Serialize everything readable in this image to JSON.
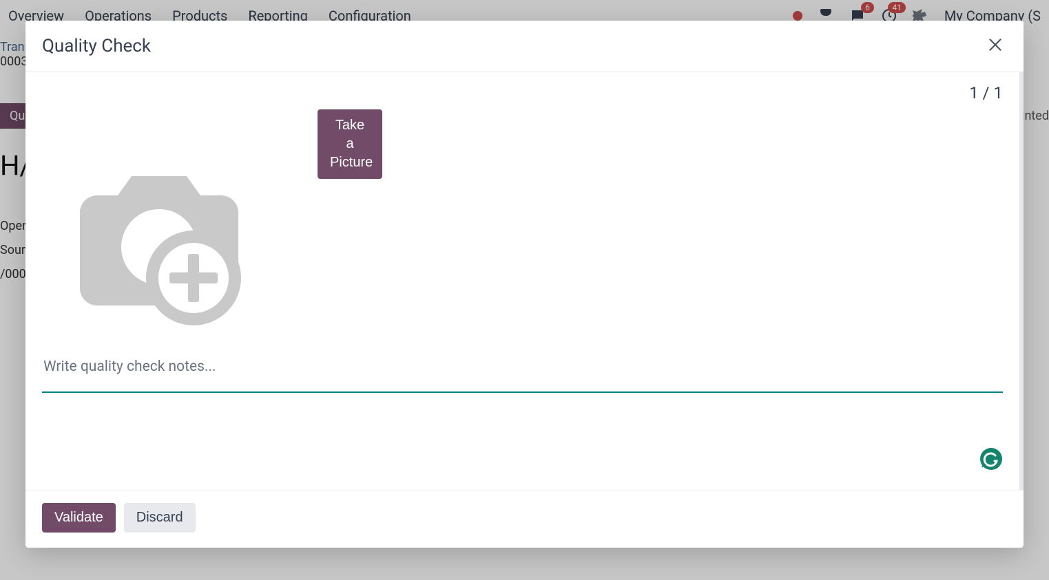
{
  "nav": {
    "items": [
      "Overview",
      "Operations",
      "Products",
      "Reporting",
      "Configuration"
    ],
    "badges": {
      "messages": "6",
      "activities": "41"
    },
    "company": "My Company (S"
  },
  "breadcrumb": {
    "line1": "Transfers",
    "line2": "0003"
  },
  "bg": {
    "quality_btn": "Quality Check",
    "title_fragment": "H/",
    "row1": "Operations Type",
    "row2": "Source",
    "row3": "/000",
    "right_tag": "Unprinted"
  },
  "modal": {
    "title": "Quality Check",
    "counter": "1 / 1",
    "take_picture": "Take a Picture",
    "notes_placeholder": "Write quality check notes...",
    "footer": {
      "validate": "Validate",
      "discard": "Discard"
    }
  }
}
